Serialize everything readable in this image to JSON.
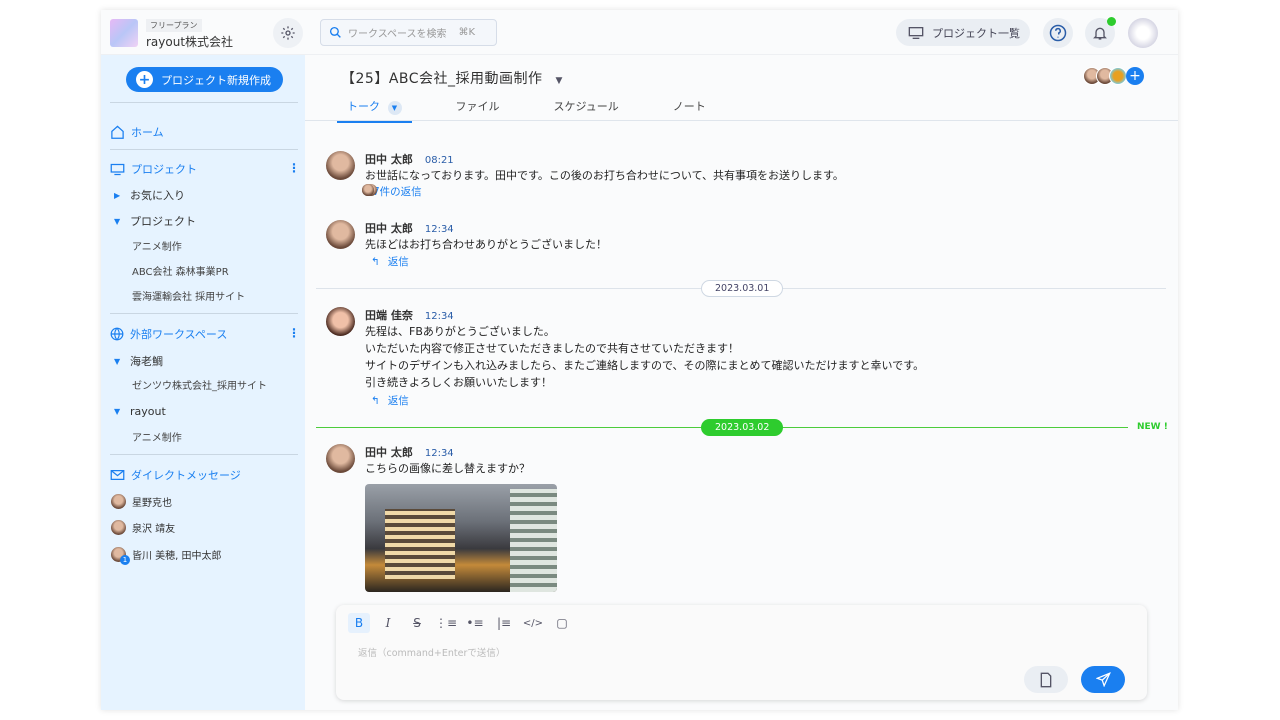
{
  "header": {
    "plan": "フリープラン",
    "company": "rayout株式会社",
    "search_placeholder": "ワークスペースを検索",
    "search_shortcut": "⌘K",
    "project_list": "プロジェクト一覧"
  },
  "sidebar": {
    "new_project": "プロジェクト新規作成",
    "home": "ホーム",
    "projects_section": "プロジェクト",
    "favorites": "お気に入り",
    "projects_group": "プロジェクト",
    "projects": [
      "アニメ制作",
      "ABC会社 森林事業PR",
      "雲海運輸会社 採用サイト"
    ],
    "external_section": "外部ワークスペース",
    "workspaces": [
      {
        "name": "海老鯛",
        "items": [
          "ゼンツウ株式会社_採用サイト"
        ]
      },
      {
        "name": "rayout",
        "items": [
          "アニメ制作"
        ]
      }
    ],
    "dm_section": "ダイレクトメッセージ",
    "dms": [
      {
        "name": "星野克也"
      },
      {
        "name": "泉沢 靖友"
      },
      {
        "name": "皆川 美穂, 田中太郎",
        "badge": "1"
      }
    ]
  },
  "channel": {
    "title": "【25】ABC会社_採用動画制作",
    "tabs": [
      "トーク",
      "ファイル",
      "スケジュール",
      "ノート"
    ]
  },
  "messages": [
    {
      "name": "田中 太郎",
      "time": "08:21",
      "lines": [
        "お世話になっております。田中です。この後のお打ち合わせについて、共有事項をお送りします。"
      ],
      "reply": "7件の返信"
    },
    {
      "name": "田中 太郎",
      "time": "12:34",
      "lines": [
        "先ほどはお打ち合わせありがとうございました！"
      ],
      "reply": "返信"
    },
    {
      "name": "田端 佳奈",
      "time": "12:34",
      "lines": [
        "先程は、FBありがとうございました。",
        "いただいた内容で修正させていただきましたので共有させていただきます！",
        "サイトのデザインも入れ込みましたら、またご連絡しますので、その際にまとめて確認いただけますと幸いです。",
        "引き続きよろしくお願いいたします！"
      ],
      "reply": "返信"
    },
    {
      "name": "田中 太郎",
      "time": "12:34",
      "lines": [
        "こちらの画像に差し替えますか？"
      ]
    }
  ],
  "dates": [
    "2023.03.01",
    "2023.03.02"
  ],
  "new_label": "NEW !",
  "composer": {
    "placeholder": "返信（command+Enterで送信）"
  },
  "colors": {
    "accent": "#1a7ff0",
    "new": "#2ecc2e",
    "sidebar": "#e6f3ff"
  }
}
